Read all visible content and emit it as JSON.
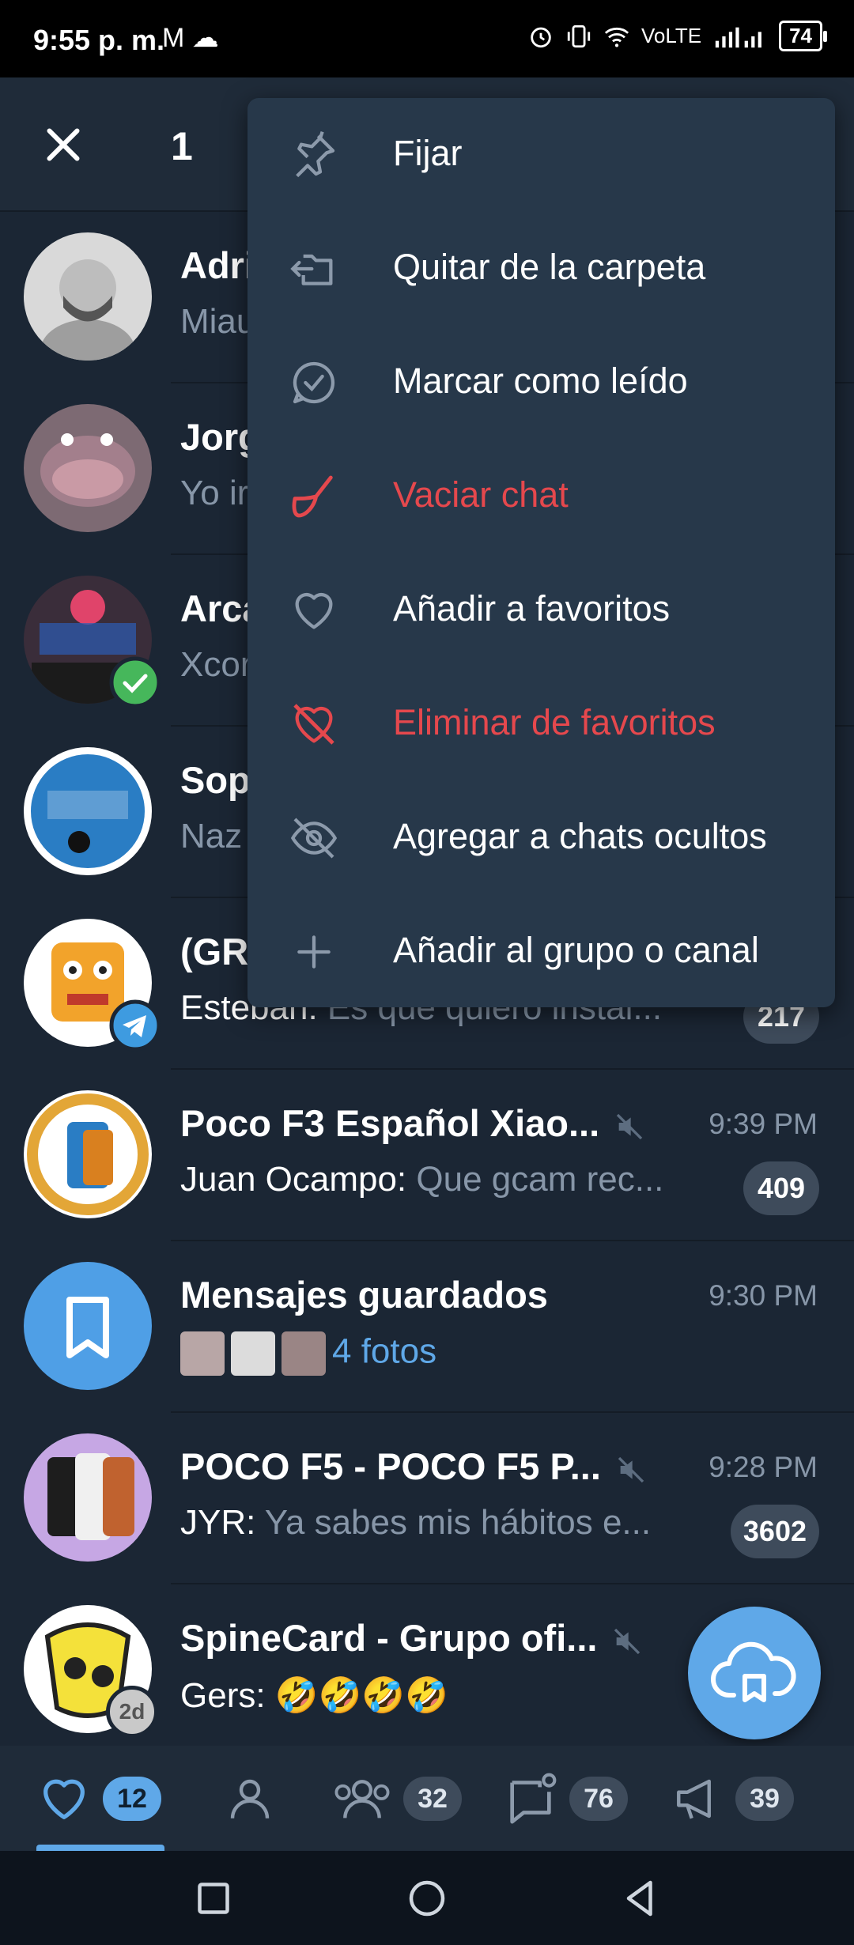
{
  "status_bar": {
    "time": "9:55 p. m.",
    "left_icons": "M ☁",
    "network": "VoLTE",
    "battery": "74"
  },
  "action_bar": {
    "selected_count": "1",
    "close_icon": "close-icon"
  },
  "chats": [
    {
      "title": "Adri",
      "message": "Miau",
      "avatar_color": "#d9d9d9"
    },
    {
      "title": "Jorg",
      "message": "Yo ir",
      "avatar_color": "#8a6f7a"
    },
    {
      "title": "Arca",
      "message": "Xcor",
      "avatar_color": "#3a2d3a"
    },
    {
      "title": "Sop",
      "message": "Naz",
      "avatar_color": "#2a7dc4"
    },
    {
      "title": "(GR",
      "sender": "Esteban:",
      "message": " Es que quiero instal...",
      "badge": "217",
      "avatar_color": "#f2a32b"
    },
    {
      "title": "Poco F3 Español Xiao...",
      "time": "9:39 PM",
      "sender": "Juan Ocampo:",
      "message": " Que gcam rec...",
      "badge": "409",
      "muted": true,
      "avatar_color": "#e3a637"
    },
    {
      "title": "Mensajes guardados",
      "time": "9:30 PM",
      "message": "4 fotos",
      "avatar_color": "#4f9fe6"
    },
    {
      "title": "POCO F5 - POCO F5 P...",
      "time": "9:28 PM",
      "sender": "JYR:",
      "message": " Ya sabes mis hábitos e...",
      "badge": "3602",
      "muted": true,
      "avatar_color": "#c6a7e4"
    },
    {
      "title": "SpineCard - Grupo ofi...",
      "sender": "Gers:",
      "message": " 🤣🤣🤣🤣",
      "muted": true,
      "avatar_color": "#f4e13a",
      "avatar_badge": "2d"
    }
  ],
  "context_menu": {
    "items": [
      {
        "label": "Fijar",
        "icon": "pin-icon",
        "danger": false
      },
      {
        "label": "Quitar de la carpeta",
        "icon": "folder-remove-icon",
        "danger": false
      },
      {
        "label": "Marcar como leído",
        "icon": "mark-read-icon",
        "danger": false
      },
      {
        "label": "Vaciar chat",
        "icon": "broom-icon",
        "danger": true
      },
      {
        "label": "Añadir a favoritos",
        "icon": "heart-icon",
        "danger": false
      },
      {
        "label": "Eliminar de favoritos",
        "icon": "heart-remove-icon",
        "danger": true
      },
      {
        "label": "Agregar a chats ocultos",
        "icon": "eye-off-icon",
        "danger": false
      },
      {
        "label": "Añadir al grupo o canal",
        "icon": "plus-icon",
        "danger": false
      }
    ]
  },
  "tabs": [
    {
      "icon": "heart-icon",
      "badge": "12",
      "active": true
    },
    {
      "icon": "person-icon",
      "badge": ""
    },
    {
      "icon": "group-icon",
      "badge": "32"
    },
    {
      "icon": "chat-icon",
      "badge": "76"
    },
    {
      "icon": "megaphone-icon",
      "badge": "39"
    }
  ],
  "colors": {
    "background": "#1b2634",
    "accent": "#5fa8e8",
    "danger": "#e5484d",
    "menu": "#27384a"
  }
}
